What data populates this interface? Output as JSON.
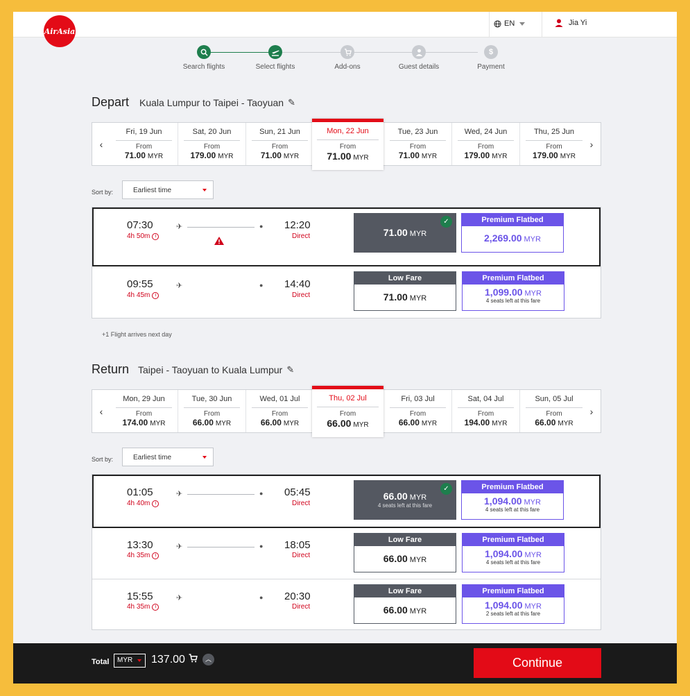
{
  "header": {
    "logo_text": "AirAsia",
    "language": "EN",
    "user_name": "Jia Yi"
  },
  "steps": [
    {
      "label": "Search flights",
      "icon": "search-icon",
      "state": "done"
    },
    {
      "label": "Select flights",
      "icon": "plane-departure-icon",
      "state": "current"
    },
    {
      "label": "Add-ons",
      "icon": "cart-icon",
      "state": "pending"
    },
    {
      "label": "Guest details",
      "icon": "user-icon",
      "state": "pending"
    },
    {
      "label": "Payment",
      "icon": "dollar-icon",
      "state": "pending"
    }
  ],
  "depart": {
    "title": "Depart",
    "route": "Kuala Lumpur to Taipei - Taoyuan",
    "dates": [
      {
        "day": "Fri, 19 Jun",
        "from": "From",
        "price": "71.00",
        "cur": "MYR"
      },
      {
        "day": "Sat, 20 Jun",
        "from": "From",
        "price": "179.00",
        "cur": "MYR"
      },
      {
        "day": "Sun, 21 Jun",
        "from": "From",
        "price": "71.00",
        "cur": "MYR"
      },
      {
        "day": "Mon, 22 Jun",
        "from": "From",
        "price": "71.00",
        "cur": "MYR",
        "selected": true
      },
      {
        "day": "Tue, 23 Jun",
        "from": "From",
        "price": "71.00",
        "cur": "MYR"
      },
      {
        "day": "Wed, 24 Jun",
        "from": "From",
        "price": "179.00",
        "cur": "MYR"
      },
      {
        "day": "Thu, 25 Jun",
        "from": "From",
        "price": "179.00",
        "cur": "MYR"
      }
    ],
    "sort_label": "Sort by:",
    "sort_value": "Earliest time",
    "flights": [
      {
        "dep": "07:30",
        "dur": "4h 50m",
        "arr": "12:20",
        "stops": "Direct",
        "warning": true,
        "low": {
          "header": "",
          "price": "71.00",
          "cur": "MYR",
          "seats": "",
          "selected": true
        },
        "premium": {
          "header": "Premium Flatbed",
          "price": "2,269.00",
          "cur": "MYR",
          "seats": ""
        }
      },
      {
        "dep": "09:55",
        "dur": "4h 45m",
        "arr": "14:40",
        "stops": "Direct",
        "warning": false,
        "low": {
          "header": "Low Fare",
          "price": "71.00",
          "cur": "MYR",
          "seats": "",
          "selected": false
        },
        "premium": {
          "header": "Premium Flatbed",
          "price": "1,099.00",
          "cur": "MYR",
          "seats": "4 seats left at this fare"
        }
      }
    ],
    "note": "+1 Flight arrives next day"
  },
  "return": {
    "title": "Return",
    "route": "Taipei - Taoyuan to Kuala Lumpur",
    "dates": [
      {
        "day": "Mon, 29 Jun",
        "from": "From",
        "price": "174.00",
        "cur": "MYR"
      },
      {
        "day": "Tue, 30 Jun",
        "from": "From",
        "price": "66.00",
        "cur": "MYR"
      },
      {
        "day": "Wed, 01 Jul",
        "from": "From",
        "price": "66.00",
        "cur": "MYR"
      },
      {
        "day": "Thu, 02 Jul",
        "from": "From",
        "price": "66.00",
        "cur": "MYR",
        "selected": true
      },
      {
        "day": "Fri, 03 Jul",
        "from": "From",
        "price": "66.00",
        "cur": "MYR"
      },
      {
        "day": "Sat, 04 Jul",
        "from": "From",
        "price": "194.00",
        "cur": "MYR"
      },
      {
        "day": "Sun, 05 Jul",
        "from": "From",
        "price": "66.00",
        "cur": "MYR"
      }
    ],
    "sort_label": "Sort by:",
    "sort_value": "Earliest time",
    "flights": [
      {
        "dep": "01:05",
        "dur": "4h 40m",
        "arr": "05:45",
        "stops": "Direct",
        "low": {
          "header": "",
          "price": "66.00",
          "cur": "MYR",
          "seats": "4 seats left at this fare",
          "selected": true
        },
        "premium": {
          "header": "Premium Flatbed",
          "price": "1,094.00",
          "cur": "MYR",
          "seats": "4 seats left at this fare"
        }
      },
      {
        "dep": "13:30",
        "dur": "4h 35m",
        "arr": "18:05",
        "stops": "Direct",
        "low": {
          "header": "Low Fare",
          "price": "66.00",
          "cur": "MYR",
          "seats": "",
          "selected": false
        },
        "premium": {
          "header": "Premium Flatbed",
          "price": "1,094.00",
          "cur": "MYR",
          "seats": "4 seats left at this fare"
        }
      },
      {
        "dep": "15:55",
        "dur": "4h 35m",
        "arr": "20:30",
        "stops": "Direct",
        "low": {
          "header": "Low Fare",
          "price": "66.00",
          "cur": "MYR",
          "seats": "",
          "selected": false
        },
        "premium": {
          "header": "Premium Flatbed",
          "price": "1,094.00",
          "cur": "MYR",
          "seats": "2 seats left at this fare"
        }
      }
    ]
  },
  "footer": {
    "total_label": "Total",
    "currency": "MYR",
    "amount": "137.00",
    "continue_label": "Continue"
  },
  "colors": {
    "brand_red": "#e30b17",
    "premium_purple": "#6b54e8",
    "step_green": "#1e7e4d",
    "selected_fare": "#545861"
  }
}
